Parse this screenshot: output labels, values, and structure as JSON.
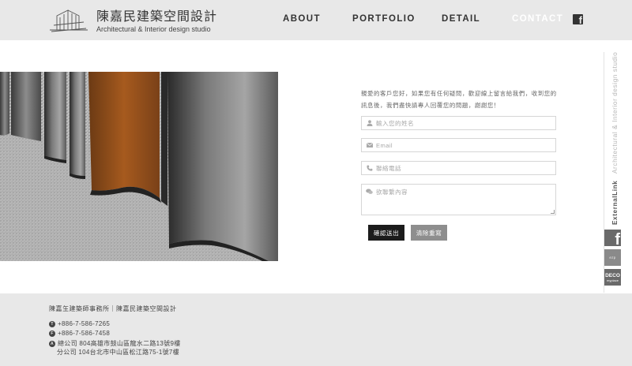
{
  "header": {
    "logo_title": "陳嘉民建築空間設計",
    "logo_subtitle": "Architectural & Interior design studio",
    "nav": [
      {
        "label": "ABOUT"
      },
      {
        "label": "PORTFOLIO"
      },
      {
        "label": "DETAIL"
      },
      {
        "label": "CONTACT",
        "active": true
      }
    ],
    "facebook_icon": "facebook-icon"
  },
  "form": {
    "intro": "親愛的客戶您好，如果您有任何疑問，歡迎線上留言給我們，收到您的訊息後，我們盡快請專人回覆您的問題，謝謝您！",
    "name_placeholder": "輸入您的姓名",
    "email_placeholder": "Email",
    "phone_placeholder": "聯絡電話",
    "message_placeholder": "欲聯繫內容",
    "submit_label": "確認送出",
    "reset_label": "清除重寫"
  },
  "sidebar": {
    "external_link": "ExternalLink",
    "studio": "Architectural & Interior design studio",
    "links": [
      "facebook",
      "ezp",
      "DECO"
    ],
    "deco_sub": "myplace"
  },
  "footer": {
    "firm": "陳嘉玍建築師事務所｜陳嘉民建築空間設計",
    "phone": "+886-7-586-7265",
    "fax": "+886-7-586-7458",
    "address_hq": "總公司 804高雄市鼓山區龍水二路13號9樓",
    "address_branch": "分公司 104台北市中山區松江路75-1號7樓",
    "phone_badge": "T",
    "fax_badge": "F",
    "address_badge": "A"
  },
  "colors": {
    "header_bg": "#e8e8e8",
    "submit_bg": "#1c1c1c",
    "reset_bg": "#8e8e8e",
    "accent_rust": "#a65a1e"
  }
}
